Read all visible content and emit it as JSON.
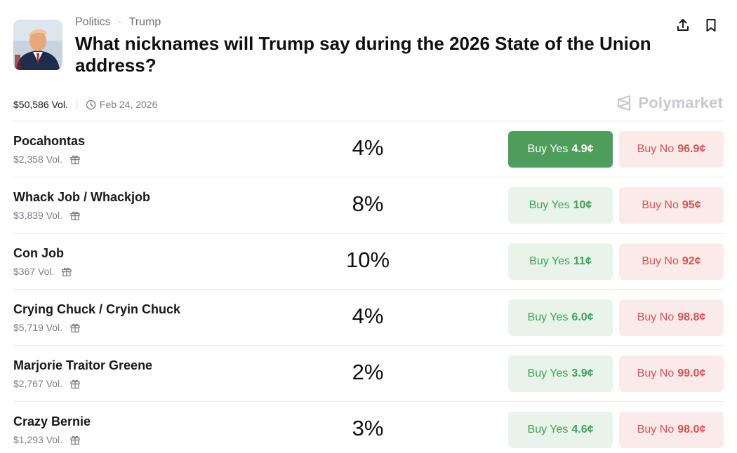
{
  "header": {
    "breadcrumb": [
      "Politics",
      "Trump"
    ],
    "breadcrumb_separator": "·",
    "title": "What nicknames will Trump say during the 2026 State of the Union address?",
    "icons": [
      "share-icon",
      "bookmark-icon"
    ]
  },
  "meta": {
    "volume": "$50,586 Vol.",
    "date": "Feb 24, 2026"
  },
  "brand": {
    "name": "Polymarket"
  },
  "colors": {
    "yes_bg": "#e8f3ea",
    "yes_text": "#3fa158",
    "yes_active_bg": "#4f9d5d",
    "no_bg": "#fbeaea",
    "no_text": "#d9534f"
  },
  "outcomes": [
    {
      "name": "Pocahontas",
      "volume": "$2,358 Vol.",
      "chance": "4%",
      "yes_label": "Buy Yes",
      "yes_price": "4.9¢",
      "no_label": "Buy No",
      "no_price": "96.9¢",
      "yes_active": true
    },
    {
      "name": "Whack Job / Whackjob",
      "volume": "$3,839 Vol.",
      "chance": "8%",
      "yes_label": "Buy Yes",
      "yes_price": "10¢",
      "no_label": "Buy No",
      "no_price": "95¢",
      "yes_active": false
    },
    {
      "name": "Con Job",
      "volume": "$367 Vol.",
      "chance": "10%",
      "yes_label": "Buy Yes",
      "yes_price": "11¢",
      "no_label": "Buy No",
      "no_price": "92¢",
      "yes_active": false
    },
    {
      "name": "Crying Chuck / Cryin Chuck",
      "volume": "$5,719 Vol.",
      "chance": "4%",
      "yes_label": "Buy Yes",
      "yes_price": "6.0¢",
      "no_label": "Buy No",
      "no_price": "98.8¢",
      "yes_active": false
    },
    {
      "name": "Marjorie Traitor Greene",
      "volume": "$2,767 Vol.",
      "chance": "2%",
      "yes_label": "Buy Yes",
      "yes_price": "3.9¢",
      "no_label": "Buy No",
      "no_price": "99.0¢",
      "yes_active": false
    },
    {
      "name": "Crazy Bernie",
      "volume": "$1,293 Vol.",
      "chance": "3%",
      "yes_label": "Buy Yes",
      "yes_price": "4.6¢",
      "no_label": "Buy No",
      "no_price": "98.0¢",
      "yes_active": false
    }
  ]
}
